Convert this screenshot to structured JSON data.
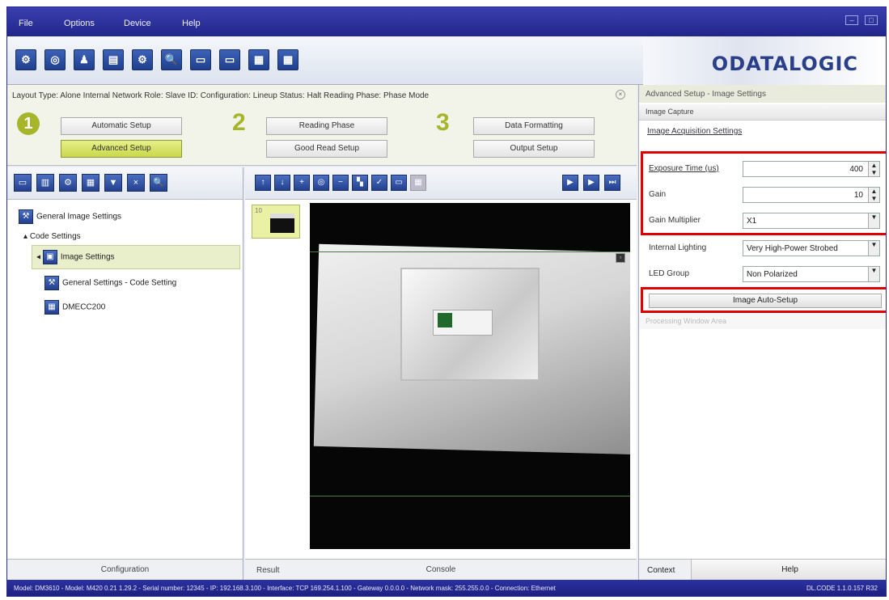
{
  "menu": {
    "file": "File",
    "options": "Options",
    "device": "Device",
    "help": "Help"
  },
  "window_buttons": {
    "minimize": "–",
    "maximize": "□"
  },
  "toolbar": {
    "icons": [
      "connect-icon",
      "camera-icon",
      "beaker-icon",
      "document-icon",
      "settings-icon",
      "search-device-icon",
      "save-icon",
      "send-icon",
      "network-icon",
      "monitor-icon"
    ],
    "glyphs": [
      "⚙",
      "◎",
      "♟",
      "▤",
      "⚙",
      "🔍",
      "▭",
      "▭",
      "▦",
      "▦"
    ]
  },
  "brand": "ODATALOGIC",
  "wizard": {
    "layout_line": "Layout Type: Alone   Internal Network Role: Slave ID:  Configuration: Lineup  Status: Halt   Reading Phase: Phase Mode",
    "close": "×",
    "step1_num": "1",
    "step2_num": "2",
    "step3_num": "3",
    "buttons": {
      "automatic_setup": "Automatic Setup",
      "advanced_setup": "Advanced Setup",
      "reading_phase": "Reading Phase",
      "good_read_setup": "Good Read Setup",
      "data_formatting": "Data Formatting",
      "output_setup": "Output Setup"
    }
  },
  "right_panel": {
    "title": "Advanced Setup - Image Settings",
    "group": "Image Capture",
    "link": "Image Acquisition Settings",
    "exposure_label": "Exposure Time (us)",
    "exposure_value": "400",
    "gain_label": "Gain",
    "gain_value": "10",
    "gain_multiplier_label": "Gain Multiplier",
    "gain_multiplier_value": "X1",
    "internal_lighting_label": "Internal Lighting",
    "internal_lighting_value": "Very High-Power Strobed",
    "led_group_label": "LED Group",
    "led_group_value": "Non Polarized",
    "auto_setup_button": "Image Auto-Setup",
    "group2": "Processing Window Area",
    "tab_context": "Context",
    "tab_help": "Help"
  },
  "left_panel": {
    "tree": {
      "general_image_settings": "General Image Settings",
      "code_settings": "Code Settings",
      "image_settings": "Image Settings",
      "general_settings": "General Settings - Code Setting",
      "code_item": "DMECC200"
    },
    "footer": "Configuration"
  },
  "center": {
    "thumb_num": "10",
    "footer_left": "Result",
    "footer_center": "Console"
  },
  "status": {
    "left": "Model: DM3610 - Model: M420 0.21 1.29.2 - Serial number: 12345 - IP: 192.168.3.100 - Interface: TCP 169.254.1.100 - Gateway 0.0.0.0 - Network mask: 255.255.0.0 - Connection: Ethernet",
    "right": "DL.CODE 1.1.0.157 R32"
  }
}
